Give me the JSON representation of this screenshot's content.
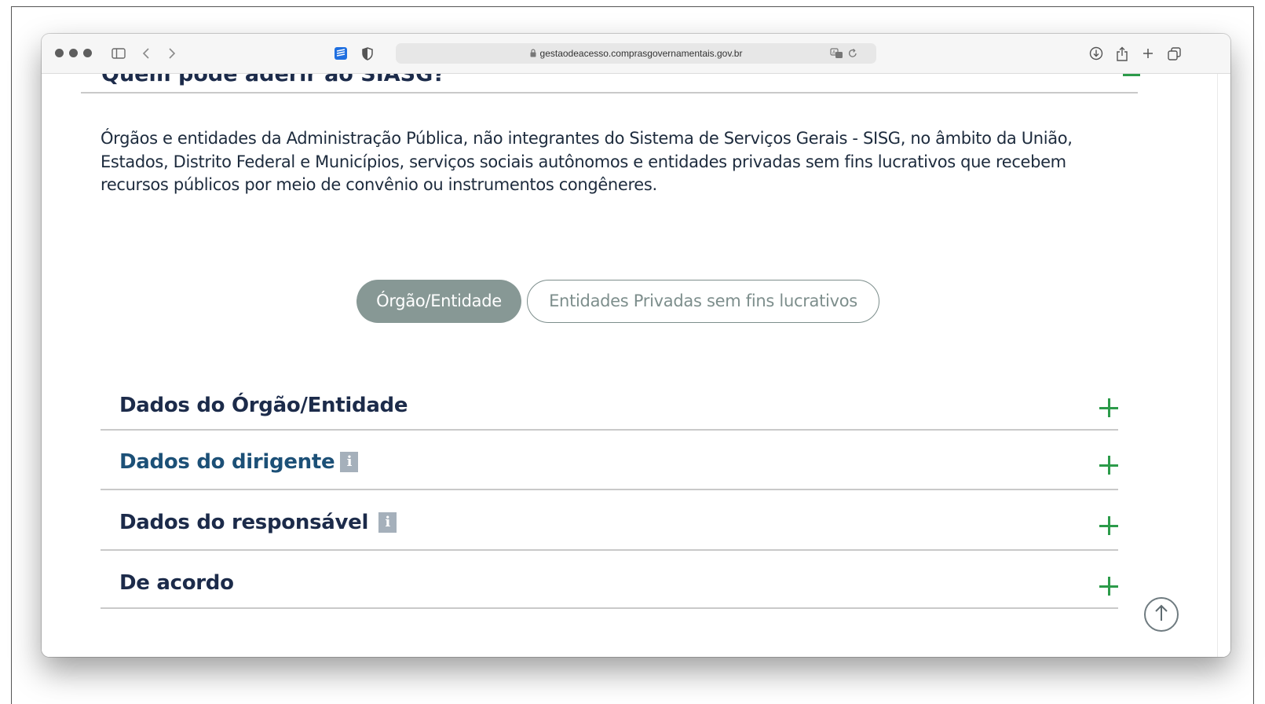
{
  "browser": {
    "url": "gestaodeacesso.comprasgovernamentais.gov.br",
    "toolbar_icons": [
      "sidebar-icon",
      "back-icon",
      "forward-icon",
      "extension-icon",
      "shield-icon",
      "lock-icon",
      "translate-icon",
      "reload-icon",
      "download-icon",
      "share-icon",
      "new-tab-icon",
      "tabs-overview-icon"
    ]
  },
  "section": {
    "heading": "Quem pode aderir ao SIASG?",
    "description": "Órgãos e entidades da Administração Pública, não integrantes do Sistema de Serviços Gerais - SISG, no âmbito da União, Estados, Distrito Federal e Municípios, serviços sociais autônomos e entidades privadas sem fins lucrativos que recebem recursos públicos por meio de convênio ou instrumentos congêneres."
  },
  "segmented": {
    "options": [
      "Órgão/Entidade",
      "Entidades Privadas sem fins lucrativos"
    ],
    "selected": "Órgão/Entidade"
  },
  "accordion": {
    "items": [
      {
        "label": "Dados do Órgão/Entidade"
      },
      {
        "label": "Dados do dirigente"
      },
      {
        "label": "Dados do responsável"
      },
      {
        "label": "De acordo"
      }
    ],
    "info_glyph": "i"
  },
  "colors": {
    "accent_green": "#2c9b4a",
    "segment_active": "#879895",
    "heading_dark": "#1c2b4a",
    "heading_blue": "#1c5077"
  }
}
